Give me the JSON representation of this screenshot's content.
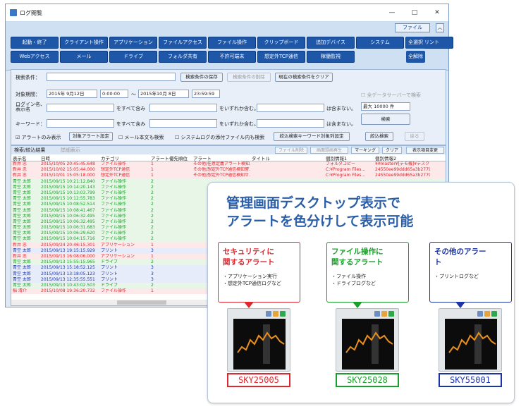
{
  "window": {
    "title": "ログ閲覧",
    "min": "—",
    "max": "□",
    "close": "✕",
    "file_button": "ファイル",
    "collapse": "︿"
  },
  "categories": [
    "起動・終了",
    "クライアント操作",
    "アプリケーション",
    "ファイルアクセス",
    "ファイル操作",
    "クリップボード",
    "追加デバイス",
    "システム",
    "プリント",
    "Webアクセス",
    "メール",
    "ドライブ",
    "フォルダ共有",
    "不許可端末",
    "想定外TCP通信",
    "稼働監視"
  ],
  "select_all": "全選択",
  "deselect_all": "全解除",
  "search": {
    "cond_label": "検索条件：",
    "save": "検索条件の保存",
    "delete": "検索条件の削除",
    "clear": "現在の検索条件をクリア",
    "period_label": "対象期間：",
    "date_from": "2015年 9月12日",
    "time_from": "0:00:00",
    "tilde": "〜",
    "date_to": "2015年10月 8日",
    "time_to": "23:59:59",
    "login_label": "ログイン名、表示名",
    "contains_all": "をすべて含み",
    "contains_any": "をいずれか含む。",
    "not_contains": "は含まない。",
    "keyword_label": "キーワード：",
    "alert_only": "アラートのみ表示",
    "target_alert": "対象アラート設定",
    "mail_body": "メール本文も検索",
    "attach": "システムログの添付ファイル内も検索",
    "kw_setting": "絞込検索キーワード対象列設定",
    "all_servers": "全データサーバーで検索",
    "max": "最大 10000 件",
    "search_btn": "検索",
    "narrow": "絞込検索",
    "back": "戻る"
  },
  "results": {
    "tab": "検索/絞込結果",
    "detail": "詳細表示",
    "file_del": "ファイル削除",
    "img_play": "画面録画再生",
    "marking": "マーキング",
    "clear": "クリア",
    "col_change": "表示項目変更",
    "columns": [
      "表示名",
      "日時",
      "カテゴリ",
      "アラート優先順位",
      "アラート",
      "タイトル",
      "個別情報1",
      "個別情報2"
    ],
    "rows": [
      [
        "新井 忠",
        "2015/10/05 20:45:45.648",
        "ファイル操作",
        "1",
        "その他/任意定義アラート検知...",
        "",
        "フォルダコピー",
        "¥¥master¥[デモ機]¥デスクトップ"
      ],
      [
        "新井 忠",
        "2015/10/02 15:05:44.000",
        "想定外TCP通信",
        "1",
        "その他/想定外TCP通信検知警...",
        "",
        "C:¥Program Files...",
        "24550ee99ddd65a3b2779f13ee"
      ],
      [
        "新井 忠",
        "2015/10/01 15:05:18.000",
        "想定外TCP通信",
        "1",
        "その他/想定外TCP通信検知せ...",
        "",
        "C:¥Program Files...",
        "24550ee99ddd65a3b2779f13ee"
      ],
      [
        "青空 太郎",
        "2015/09/15 10:21:12.840",
        "ファイル操作",
        "2",
        "",
        "",
        "",
        ""
      ],
      [
        "青空 太郎",
        "2015/09/15 10:14:20.143",
        "ファイル操作",
        "2",
        "",
        "",
        "",
        ""
      ],
      [
        "青空 太郎",
        "2015/09/15 10:13:03.799",
        "ファイル操作",
        "2",
        "",
        "",
        "",
        ""
      ],
      [
        "青空 太郎",
        "2015/09/15 10:12:55.783",
        "ファイル操作",
        "2",
        "",
        "",
        "",
        ""
      ],
      [
        "青空 太郎",
        "2015/09/15 10:08:52.514",
        "ファイル操作",
        "2",
        "",
        "",
        "",
        ""
      ],
      [
        "青空 太郎",
        "2015/09/15 10:08:41.467",
        "ファイル操作",
        "2",
        "",
        "",
        "",
        ""
      ],
      [
        "青空 太郎",
        "2015/09/15 10:06:32.495",
        "ファイル操作",
        "2",
        "",
        "",
        "",
        ""
      ],
      [
        "青空 太郎",
        "2015/09/15 10:06:32.495",
        "ファイル操作",
        "2",
        "",
        "",
        "",
        ""
      ],
      [
        "青空 太郎",
        "2015/09/15 10:06:31.683",
        "ファイル操作",
        "2",
        "",
        "",
        "",
        ""
      ],
      [
        "青空 太郎",
        "2015/09/15 10:06:29.620",
        "ファイル操作",
        "2",
        "",
        "",
        "",
        ""
      ],
      [
        "青空 太郎",
        "2015/09/15 10:04:15.716",
        "ファイル操作",
        "2",
        "",
        "",
        "",
        ""
      ],
      [
        "新井 忠",
        "2015/09/24 20:46:15.301",
        "アプリケーション",
        "1",
        "",
        "",
        "",
        ""
      ],
      [
        "青空 太郎",
        "2015/09/13 19:15:15.929",
        "プリント",
        "3",
        "",
        "",
        "",
        ""
      ],
      [
        "新井 忠",
        "2015/09/13 16:08:06.000",
        "アプリケーション",
        "1",
        "",
        "",
        "",
        ""
      ],
      [
        "青空 太郎",
        "2015/09/13 15:55:15.965",
        "ドライブ",
        "2",
        "",
        "",
        "",
        ""
      ],
      [
        "青空 太郎",
        "2015/09/13 15:18:52.125",
        "プリント",
        "3",
        "",
        "",
        "",
        ""
      ],
      [
        "青空 太郎",
        "2015/09/13 13:18:05.123",
        "プリント",
        "3",
        "",
        "",
        "",
        ""
      ],
      [
        "青空 太郎",
        "2015/09/13 12:35:55.551",
        "プリント",
        "3",
        "",
        "",
        "",
        ""
      ],
      [
        "青空 太郎",
        "2015/09/13 10:43:02.503",
        "ドライブ",
        "2",
        "",
        "",
        "",
        ""
      ],
      [
        "稲 清介",
        "2015/10/08 19:36:20.732",
        "ファイル操作",
        "1",
        "",
        "",
        "",
        ""
      ]
    ]
  },
  "callout": {
    "heading1": "管理画面デスクトップ表示で",
    "heading2": "アラートを色分けして表示可能",
    "boxes": [
      {
        "title1": "セキュリティに",
        "title2": "関するアラート",
        "b1": "・アプリケーション実行",
        "b2": "・想定外TCP通信ログなど",
        "code": "SKY25005"
      },
      {
        "title1": "ファイル操作に",
        "title2": "関するアラート",
        "b1": "・ファイル操作",
        "b2": "・ドライブログなど",
        "code": "SKY25028"
      },
      {
        "title1": "その他のアラー",
        "title2": "ト",
        "b1": "・プリントログなど",
        "b2": "",
        "code": "SKY55001"
      }
    ]
  },
  "colors": {
    "security": "#e0262e",
    "file": "#1aa02a",
    "other": "#1c34a8",
    "accent": "#1e56a8"
  }
}
